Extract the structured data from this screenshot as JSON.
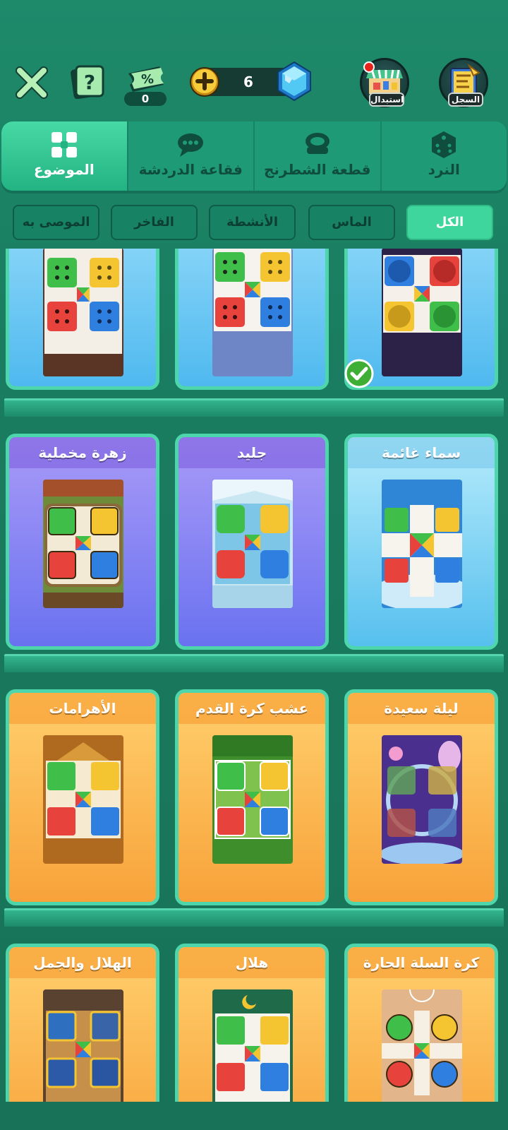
{
  "topbar": {
    "ticket_count": "0",
    "currency_value": "6",
    "exchange_label": "استبدال",
    "record_label": "السجل"
  },
  "main_tabs": [
    {
      "label": "الموضوع",
      "icon": "theme-grid-icon",
      "active": true
    },
    {
      "label": "فقاعة الدردشة",
      "icon": "chat-bubble-icon",
      "active": false
    },
    {
      "label": "قطعة الشطرنج",
      "icon": "chess-piece-icon",
      "active": false
    },
    {
      "label": "النرد",
      "icon": "dice-icon",
      "active": false
    }
  ],
  "filters": [
    {
      "label": "الكل",
      "active": true
    },
    {
      "label": "الماس",
      "active": false
    },
    {
      "label": "الأنشطة",
      "active": false
    },
    {
      "label": "الفاخر",
      "active": false
    },
    {
      "label": "الموصى به",
      "active": false
    }
  ],
  "cards": [
    {
      "title": "",
      "style": "blue",
      "theme": "snow-brown",
      "selected": false
    },
    {
      "title": "",
      "style": "blue",
      "theme": "winter",
      "selected": false
    },
    {
      "title": "",
      "style": "blue",
      "theme": "classic-dark",
      "selected": true
    },
    {
      "title": "زهرة مخملية",
      "style": "purple",
      "theme": "autumn-garden",
      "selected": false
    },
    {
      "title": "جليد",
      "style": "purple",
      "theme": "ice",
      "selected": false
    },
    {
      "title": "سماء غائمة",
      "style": "skyblue",
      "theme": "cloudy-sky",
      "selected": false
    },
    {
      "title": "الأهرامات",
      "style": "orange",
      "theme": "pyramids",
      "selected": false
    },
    {
      "title": "عشب كرة القدم",
      "style": "orange",
      "theme": "football-grass",
      "selected": false
    },
    {
      "title": "ليلة سعيدة",
      "style": "orange",
      "theme": "good-night",
      "selected": false
    },
    {
      "title": "الهلال والجمل",
      "style": "orange",
      "theme": "crescent-camel",
      "selected": false
    },
    {
      "title": "هلال",
      "style": "orange",
      "theme": "crescent",
      "selected": false
    },
    {
      "title": "كرة السلة الحارة",
      "style": "orange",
      "theme": "hot-basketball",
      "selected": false
    }
  ],
  "colors": {
    "background": "#1a7d60",
    "accent": "#3ed69c",
    "red": "#e8423c",
    "yellow": "#f5c531",
    "green": "#3fbf4a",
    "blue": "#2f7fe0"
  }
}
